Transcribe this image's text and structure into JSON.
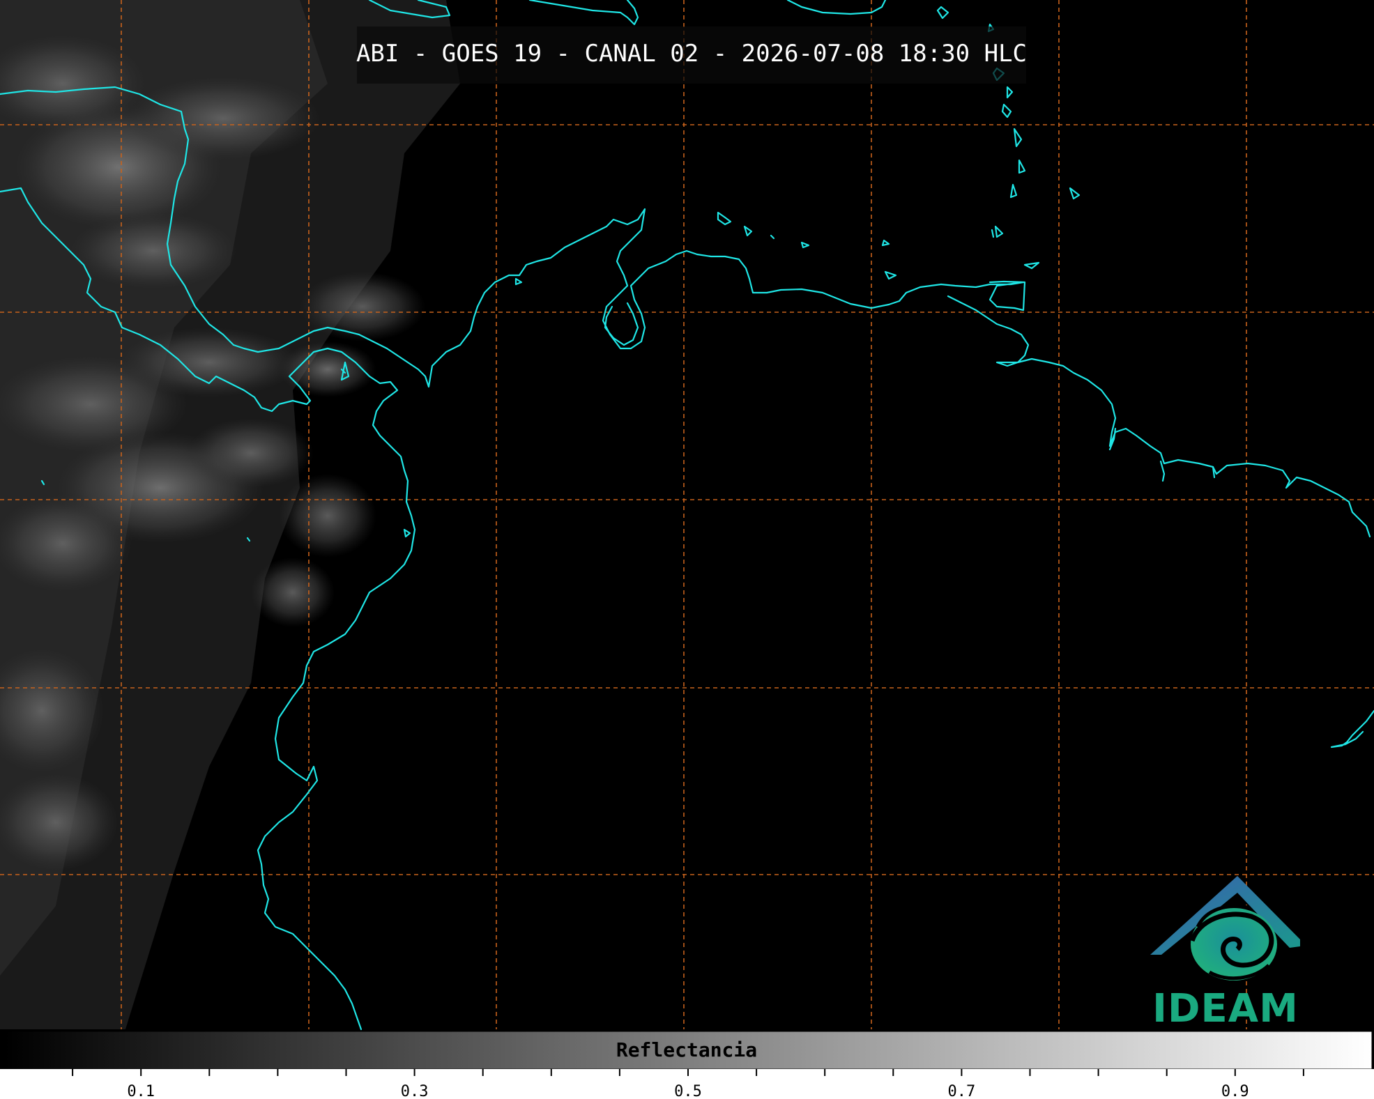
{
  "title": "ABI - GOES 19 - CANAL 02 - 2026-07-08 18:30 HLC",
  "colorbar": {
    "label": "Reflectancia",
    "ticks": [
      "0.1",
      "0.3",
      "0.5",
      "0.7",
      "0.9"
    ],
    "colormap": "grayscale",
    "color_low": "#000000",
    "color_high": "#ffffff"
  },
  "logo": {
    "text": "IDEAM",
    "color_primary": "#1aaa80",
    "color_roof": "#2f6fb0"
  },
  "colors": {
    "coastline": "#1fe6e6",
    "graticule": "#c8621c",
    "background": "#000000"
  }
}
